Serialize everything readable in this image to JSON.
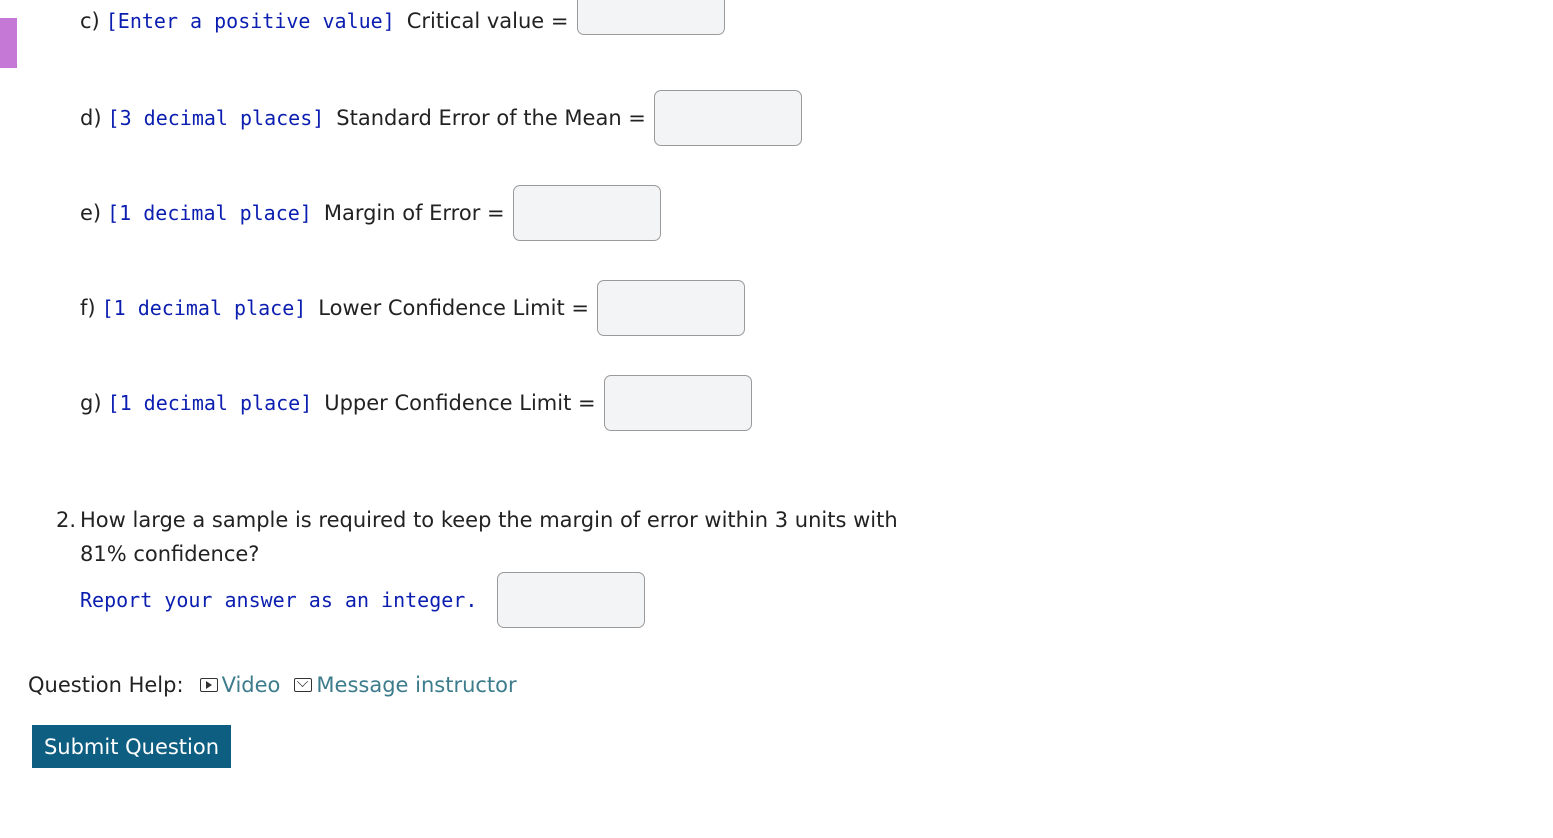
{
  "questions": {
    "c": {
      "letter": "c)",
      "hint": "[Enter a positive value]",
      "label": "Critical value =",
      "value": ""
    },
    "d": {
      "letter": "d)",
      "hint": "[3 decimal places]",
      "label": "Standard Error of the Mean =",
      "value": ""
    },
    "e": {
      "letter": "e)",
      "hint": "[1 decimal place]",
      "label": "Margin of Error =",
      "value": ""
    },
    "f": {
      "letter": "f)",
      "hint": "[1 decimal place]",
      "label": "Lower Confidence Limit =",
      "value": ""
    },
    "g": {
      "letter": "g)",
      "hint": "[1 decimal place]",
      "label": "Upper Confidence Limit =",
      "value": ""
    }
  },
  "question2": {
    "number": "2.",
    "text": "How large a sample is required to keep the margin of error within 3 units with 81% confidence?",
    "instruction": "Report your answer as an integer.",
    "value": ""
  },
  "help": {
    "label": "Question Help:",
    "video_label": "Video",
    "message_label": "Message instructor"
  },
  "submit_label": "Submit Question"
}
